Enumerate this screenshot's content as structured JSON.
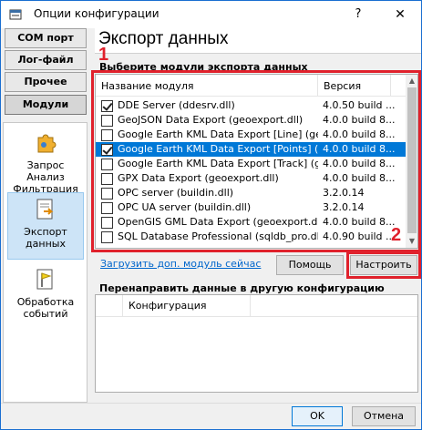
{
  "window": {
    "title": "Опции конфигурации",
    "help_label": "?",
    "close_label": "✕"
  },
  "nav": {
    "tabs": [
      {
        "label": "COM порт"
      },
      {
        "label": "Лог-файл"
      },
      {
        "label": "Прочее"
      },
      {
        "label": "Модули"
      }
    ],
    "active_tab": "Модули",
    "modules": [
      {
        "label": "Запрос Анализ Фильтрация",
        "icon": "filter-puzzle-icon"
      },
      {
        "label": "Экспорт данных",
        "icon": "export-data-icon",
        "selected": true
      },
      {
        "label": "Обработка событий",
        "icon": "flag-events-icon"
      }
    ]
  },
  "main": {
    "section_title": "Экспорт данных",
    "group_label": "Выберите модули экспорта данных",
    "columns": {
      "name": "Название модуля",
      "version": "Версия"
    },
    "rows": [
      {
        "name": "DDE Server (ddesrv.dll)",
        "version": "4.0.50 build ...",
        "checked": true,
        "selected": false
      },
      {
        "name": "GeoJSON Data Export (geoexport.dll)",
        "version": "4.0.0 build 8...",
        "checked": false,
        "selected": false
      },
      {
        "name": "Google Earth KML Data Export [Line] (geoe...",
        "version": "4.0.0 build 8...",
        "checked": false,
        "selected": false
      },
      {
        "name": "Google Earth KML Data Export [Points] (ge...",
        "version": "4.0.0 build 8...",
        "checked": true,
        "selected": true
      },
      {
        "name": "Google Earth KML Data Export [Track] (geo...",
        "version": "4.0.0 build 8...",
        "checked": false,
        "selected": false
      },
      {
        "name": "GPX Data Export (geoexport.dll)",
        "version": "4.0.0 build 8...",
        "checked": false,
        "selected": false
      },
      {
        "name": "OPC server (buildin.dll)",
        "version": "3.2.0.14",
        "checked": false,
        "selected": false
      },
      {
        "name": "OPC UA server (buildin.dll)",
        "version": "3.2.0.14",
        "checked": false,
        "selected": false
      },
      {
        "name": "OpenGIS GML Data Export (geoexport.dll)",
        "version": "4.0.0 build 8...",
        "checked": false,
        "selected": false
      },
      {
        "name": "SQL Database Professional (sqldb_pro.dll)",
        "version": "4.0.90 build ...",
        "checked": false,
        "selected": false
      }
    ],
    "annotation_1": "1",
    "annotation_2": "2",
    "load_link": "Загрузить доп. модуль сейчас",
    "help_button": "Помощь",
    "configure_button": "Настроить",
    "redirect_label": "Перенаправить данные в другую конфигурацию",
    "redirect_column": "Конфигурация"
  },
  "footer": {
    "ok_button": "OK",
    "cancel_button": "Отмена"
  },
  "colors": {
    "highlight": "#0078d7",
    "annotation_red": "#e0212c",
    "link": "#0066cc"
  }
}
